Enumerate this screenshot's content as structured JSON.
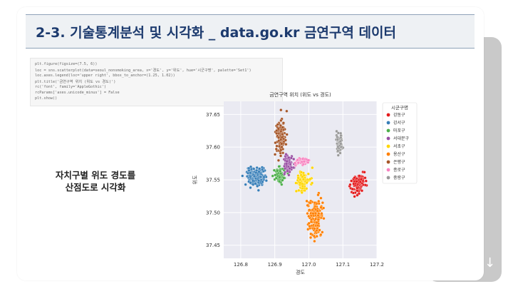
{
  "slide": {
    "title": "2-3. 기술통계분석 및 시각화 _ data.go.kr 금연구역 데이터",
    "caption_lines": [
      "자치구별 위도 경도를",
      "산점도로 시각화"
    ],
    "nav_arrow": "↓",
    "code_lines": [
      "plt.figure(figsize=(7.5, 6))",
      "loc = sns.scatterplot(data=seoul_nonsmoking_area, x='경도', y='위도', hue='시군구명', palette='Set1')",
      "loc.axes.legend(loc='upper right', bbox_to_anchor=(1.25, 1.02))",
      "plt.title('금연구역 위치 (위도 vs 경도)')",
      "rc('font', family='AppleGothic')",
      "rcParams['axes.unicode_minus'] = False",
      "plt.show()"
    ]
  },
  "chart_data": {
    "type": "scatter",
    "title": "금연구역 위치 (위도 vs 경도)",
    "xlabel": "경도",
    "ylabel": "위도",
    "xlim": [
      126.75,
      127.2
    ],
    "ylim": [
      37.43,
      37.67
    ],
    "xticks": [
      "126.8",
      "126.9",
      "127.0",
      "127.1",
      "127.2"
    ],
    "yticks": [
      "37.45",
      "37.50",
      "37.55",
      "37.60",
      "37.65"
    ],
    "grid": true,
    "legend": {
      "title": "시군구명",
      "placement": "right"
    },
    "series": [
      {
        "name": "강동구",
        "color": "#e41a1c",
        "center": [
          127.145,
          37.545
        ],
        "spread": [
          0.018,
          0.012
        ],
        "count": 90
      },
      {
        "name": "강서구",
        "color": "#377eb8",
        "center": [
          126.845,
          37.555
        ],
        "spread": [
          0.022,
          0.013
        ],
        "count": 170,
        "outliers": [
          [
            126.805,
            37.556
          ]
        ]
      },
      {
        "name": "마포구",
        "color": "#4daf4a",
        "center": [
          126.915,
          37.557
        ],
        "spread": [
          0.014,
          0.009
        ],
        "count": 90
      },
      {
        "name": "서대문구",
        "color": "#984ea3",
        "center": [
          126.94,
          37.575
        ],
        "spread": [
          0.012,
          0.012
        ],
        "count": 70
      },
      {
        "name": "서초구",
        "color": "#ffd600",
        "center": [
          126.985,
          37.548
        ],
        "spread": [
          0.016,
          0.013
        ],
        "count": 90
      },
      {
        "name": "용산구",
        "color": "#ff7f00",
        "center": [
          127.018,
          37.492
        ],
        "spread": [
          0.018,
          0.026
        ],
        "count": 160
      },
      {
        "name": "은평구",
        "color": "#a65628",
        "center": [
          126.918,
          37.618
        ],
        "spread": [
          0.013,
          0.022
        ],
        "count": 110,
        "outliers": [
          [
            126.935,
            37.655
          ]
        ]
      },
      {
        "name": "종로구",
        "color": "#f781bf",
        "center": [
          126.98,
          37.578
        ],
        "spread": [
          0.016,
          0.005
        ],
        "count": 45
      },
      {
        "name": "중랑구",
        "color": "#999999",
        "center": [
          127.09,
          37.605
        ],
        "spread": [
          0.007,
          0.013
        ],
        "count": 70
      }
    ]
  }
}
